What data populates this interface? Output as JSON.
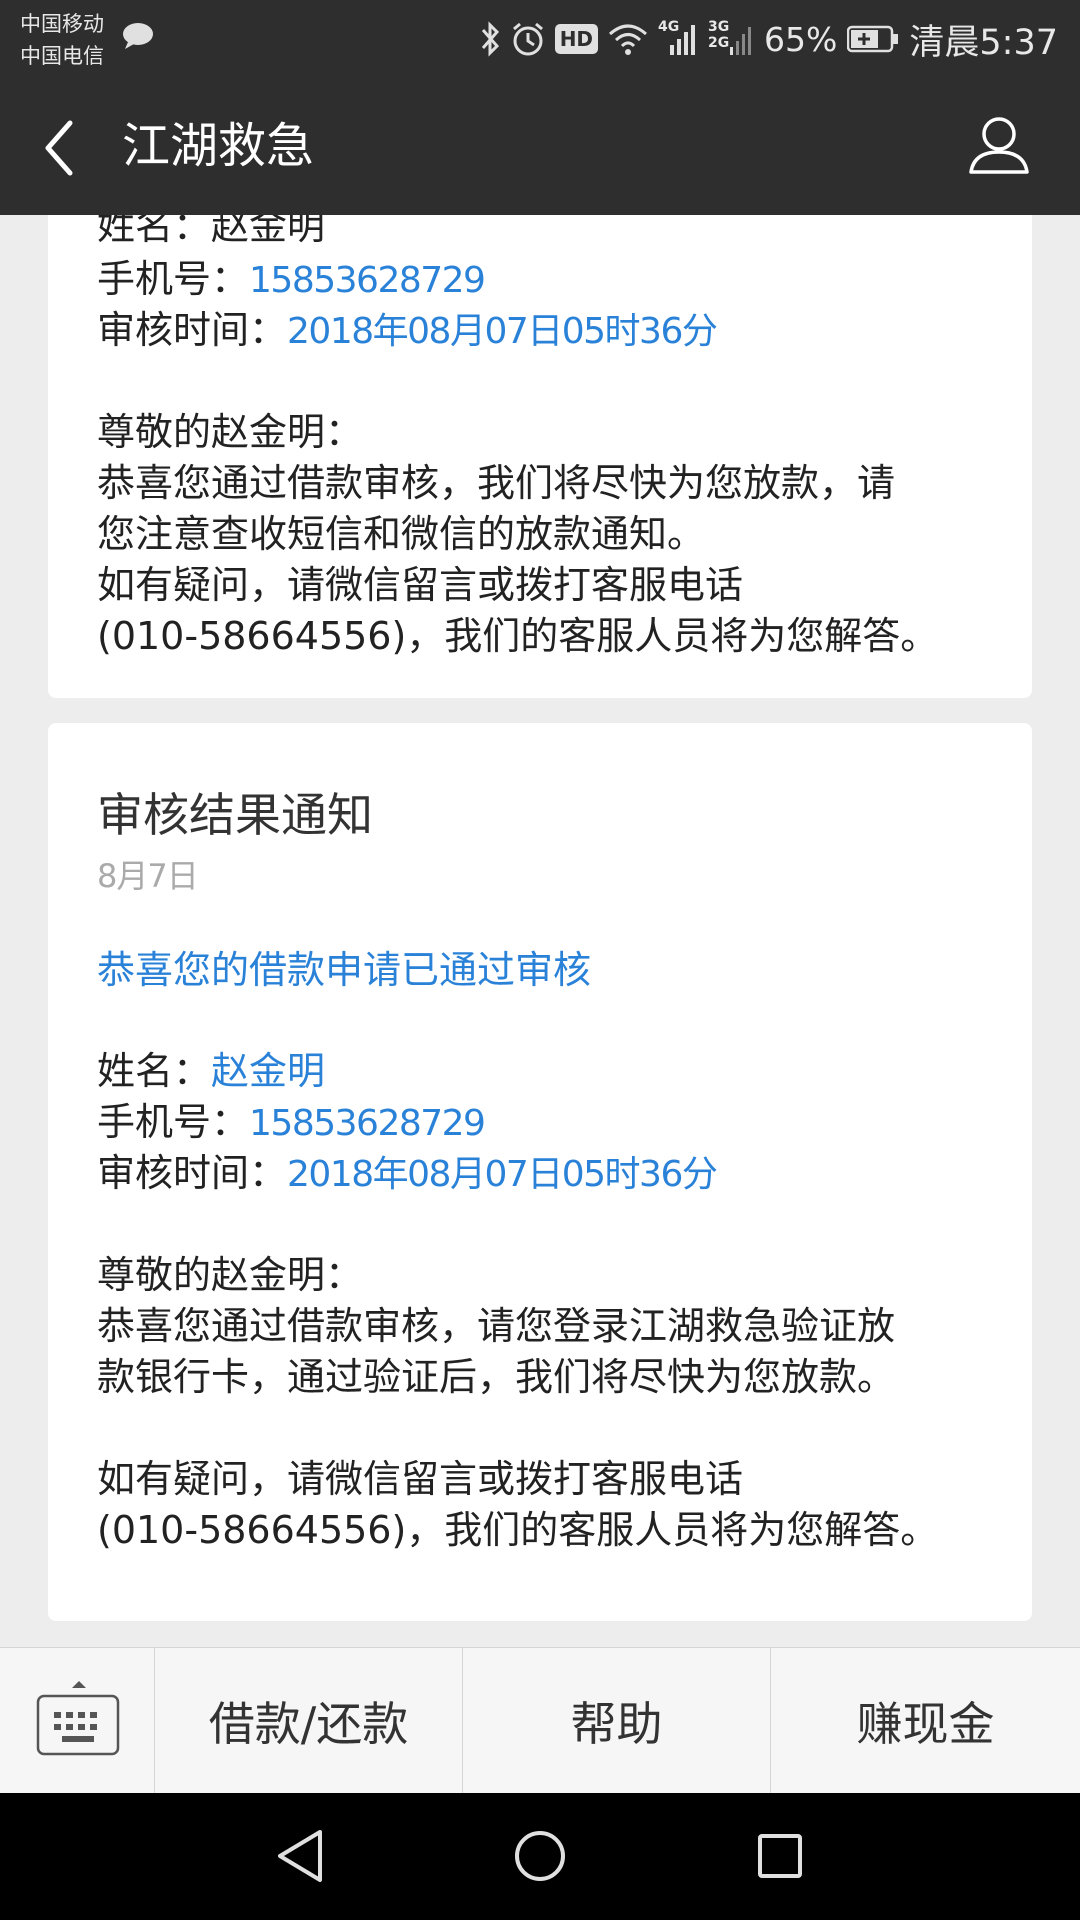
{
  "status_bar": {
    "carrier_1": "中国移动",
    "carrier_2": "中国电信",
    "network_1": "4G",
    "network_2": "3G",
    "network_3": "2G",
    "hd_label": "HD",
    "battery": "65%",
    "time": "清晨5:37"
  },
  "header": {
    "title": "江湖救急"
  },
  "card1": {
    "name_partial": "姓名：赵金明",
    "phone_label": "手机号：",
    "phone": "15853628729",
    "review_time_label": "审核时间：",
    "review_time": "2018年08月07日05时36分",
    "greeting": "尊敬的赵金明：",
    "body_line_1": "恭喜您通过借款审核，我们将尽快为您放款，请",
    "body_line_2": "您注意查收短信和微信的放款通知。",
    "body_line_3": "如有疑问，请微信留言或拨打客服电话",
    "body_line_4": "(010-58664556)，我们的客服人员将为您解答。"
  },
  "card2": {
    "title": "审核结果通知",
    "date": "8月7日",
    "headline": "恭喜您的借款申请已通过审核",
    "name_label": "姓名：",
    "name": "赵金明",
    "phone_label": "手机号：",
    "phone": "15853628729",
    "review_time_label": "审核时间：",
    "review_time": "2018年08月07日05时36分",
    "greeting": "尊敬的赵金明：",
    "body_line_1": "恭喜您通过借款审核，请您登录江湖救急验证放",
    "body_line_2": "款银行卡，通过验证后，我们将尽快为您放款。",
    "body_line_3": "如有疑问，请微信留言或拨打客服电话",
    "body_line_4": "(010-58664556)，我们的客服人员将为您解答。"
  },
  "bottom_menu": {
    "item_1": "借款/还款",
    "item_2": "帮助",
    "item_3": "赚现金"
  },
  "colors": {
    "bar_bg": "#2e2e2e",
    "link_blue": "#2a82d8",
    "page_bg": "#ededed"
  }
}
